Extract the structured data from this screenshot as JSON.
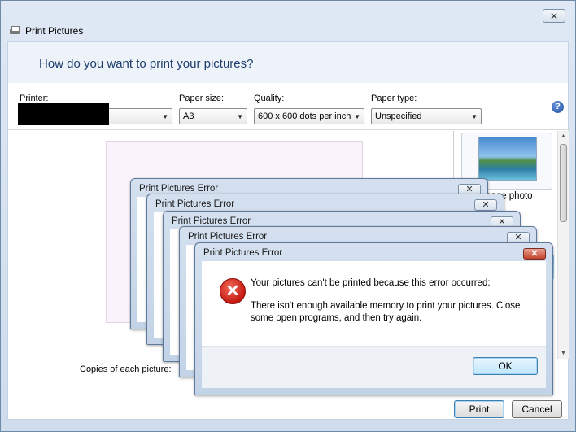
{
  "window": {
    "title": "Print Pictures",
    "close_glyph": "✕"
  },
  "header": {
    "question": "How do you want to print your pictures?"
  },
  "options": {
    "printer_label": "Printer:",
    "paper_size_label": "Paper size:",
    "paper_size_value": "A3",
    "quality_label": "Quality:",
    "quality_value": "600 x 600 dots per inch",
    "paper_type_label": "Paper type:",
    "paper_type_value": "Unspecified",
    "help_glyph": "?"
  },
  "layout": {
    "thumb_label": "page photo"
  },
  "copies": {
    "label": "Copies of each picture:"
  },
  "buttons": {
    "print": "Print",
    "cancel": "Cancel"
  },
  "error_dialogs": {
    "titles": [
      "Print Pictures Error",
      "Print Pictures Error",
      "Print Pictures Error",
      "Print Pictures Error",
      "Print Pictures Error"
    ],
    "close_glyph": "✕",
    "icon_glyph": "✕",
    "message_line1": "Your pictures can't be printed because this error occurred:",
    "message_line2": "There isn't enough available memory to print your pictures.  Close some open programs, and then try again.",
    "ok_label": "OK"
  },
  "colors": {
    "title_text": "#1f3e6e",
    "error_red": "#c41a12",
    "accent_blue": "#3c7fb1"
  }
}
